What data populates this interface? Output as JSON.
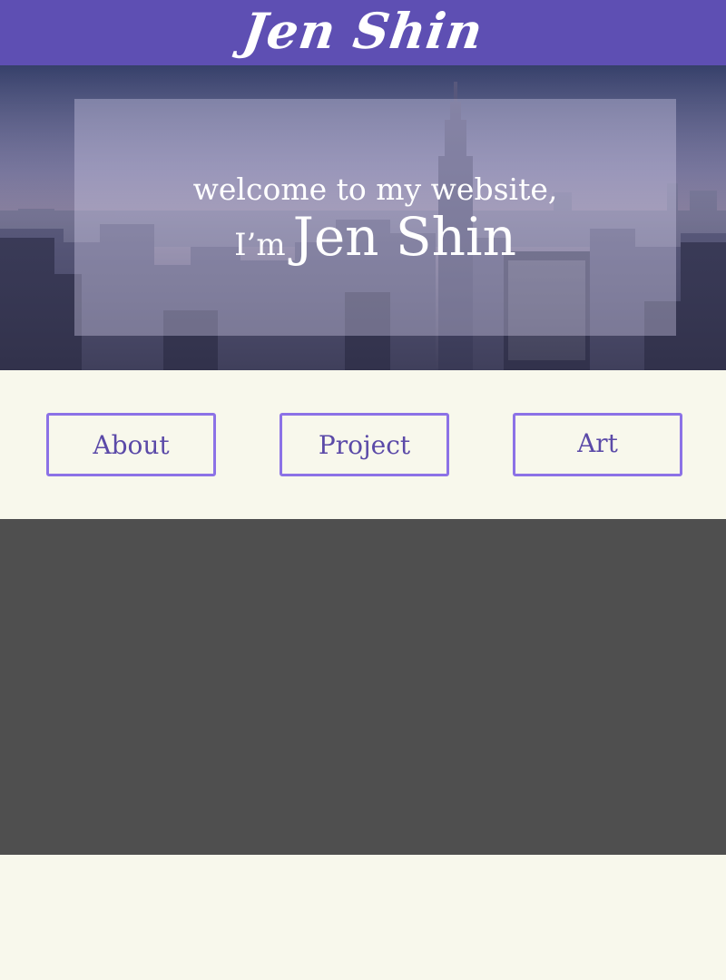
{
  "header": {
    "brand": "Jen Shin"
  },
  "hero": {
    "welcome": "welcome to my website,",
    "prefix": "I’m",
    "name": "Jen Shin",
    "background": "city-skyline-image"
  },
  "nav": {
    "buttons": [
      {
        "label": "About"
      },
      {
        "label": "Project"
      },
      {
        "label": "Art"
      }
    ]
  },
  "colors": {
    "header_bg": "#5e4fb3",
    "button_border": "#8c72e6",
    "button_text": "#5b4aa8",
    "page_bg": "#f8f8ec",
    "dark_section": "#4f4f4f"
  }
}
